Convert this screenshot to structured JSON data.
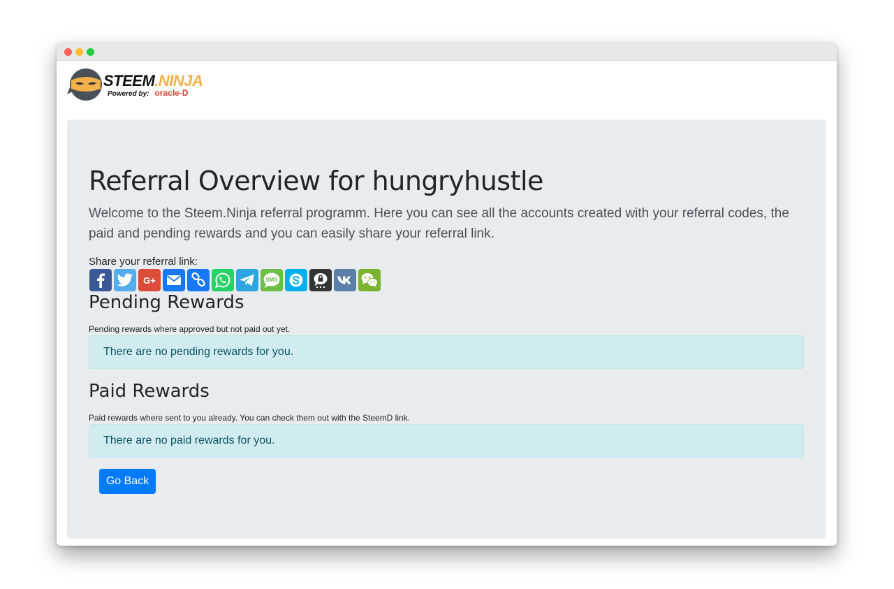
{
  "logo": {
    "brand": "STEEM",
    "brand_accent": ".NINJA",
    "powered_by": "Powered by:",
    "partner": "oracle-D"
  },
  "page": {
    "title": "Referral Overview for hungryhustle",
    "lead": "Welcome to the Steem.Ninja referral programm. Here you can see all the accounts created with your referral codes, the paid and pending rewards and you can easily share your referral link."
  },
  "share": {
    "label": "Share your referral link:",
    "buttons": [
      {
        "name": "facebook",
        "color": "#3b5998"
      },
      {
        "name": "twitter",
        "color": "#55acee"
      },
      {
        "name": "google-plus",
        "color": "#dd4b39"
      },
      {
        "name": "email",
        "color": "#1877f2"
      },
      {
        "name": "copy-link",
        "color": "#1877f2"
      },
      {
        "name": "whatsapp",
        "color": "#25d366"
      },
      {
        "name": "telegram",
        "color": "#2ca5e0"
      },
      {
        "name": "sms",
        "color": "#6cbe45"
      },
      {
        "name": "skype",
        "color": "#00aff0"
      },
      {
        "name": "threema",
        "color": "#333333"
      },
      {
        "name": "vk",
        "color": "#5b7fa6"
      },
      {
        "name": "wechat",
        "color": "#7bb32e"
      }
    ],
    "sms_text": "SMS",
    "google_text": "G+"
  },
  "pending": {
    "heading": "Pending Rewards",
    "note": "Pending rewards where approved but not paid out yet.",
    "empty": "There are no pending rewards for you."
  },
  "paid": {
    "heading": "Paid Rewards",
    "note": "Paid rewards where sent to you already. You can check them out with the SteemD link.",
    "empty": "There are no paid rewards for you."
  },
  "actions": {
    "back_label": "Go Back"
  }
}
